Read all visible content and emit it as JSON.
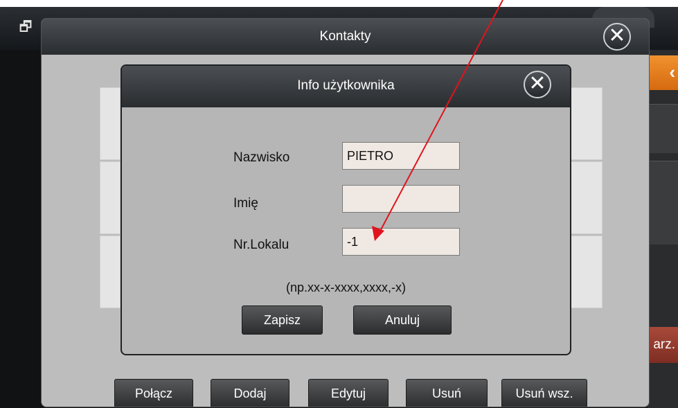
{
  "main_window": {
    "title": "Kontakty",
    "bottom_buttons": [
      "Połącz",
      "Dodaj",
      "Edytuj",
      "Usuń",
      "Usuń wsz."
    ]
  },
  "right_side": {
    "button_partial_label": "arz."
  },
  "dialog": {
    "title": "Info użytkownika",
    "fields": [
      {
        "label": "Nazwisko",
        "value": "PIETRO"
      },
      {
        "label": "Imię",
        "value": ""
      },
      {
        "label": "Nr.Lokalu",
        "value": "-1"
      }
    ],
    "hint": "(np.xx-x-xxxx,xxxx,-x)",
    "save_label": "Zapisz",
    "cancel_label": "Anuluj"
  },
  "icons": {
    "close": "close-icon",
    "window": "window-icon",
    "back_arrow": "chevron-left-icon"
  },
  "colors": {
    "titlebar": "#3a3d40",
    "dialog_bg": "#b6b6b6",
    "input_bg": "#f0e9e3",
    "annotation_arrow": "#e0141e",
    "orange_accent": "#e57f20"
  }
}
